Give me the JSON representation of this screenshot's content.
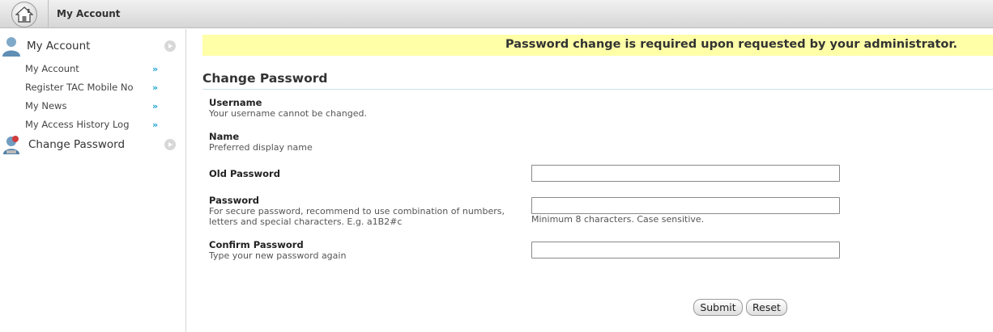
{
  "header": {
    "title": "My Account",
    "home_icon": "home-icon"
  },
  "sidebar": {
    "groups": [
      {
        "label": "My Account",
        "icon": "user-icon",
        "items": [
          {
            "label": "My Account"
          },
          {
            "label": "Register TAC Mobile No"
          },
          {
            "label": "My News"
          },
          {
            "label": "My Access History Log"
          }
        ]
      },
      {
        "label": "Change Password",
        "icon": "password-change-icon",
        "items": []
      }
    ]
  },
  "notice": "Password change is required upon requested by your administrator.",
  "form": {
    "title": "Change Password",
    "username": {
      "label": "Username",
      "desc": "Your username cannot be changed."
    },
    "name": {
      "label": "Name",
      "desc": "Preferred display name"
    },
    "old_password": {
      "label": "Old Password",
      "value": ""
    },
    "password": {
      "label": "Password",
      "desc_line1": "For secure password, recommend to use combination of numbers,",
      "desc_line2": "letters and special characters. E.g. a1B2#c",
      "value": "",
      "hint": "Minimum 8 characters. Case sensitive."
    },
    "confirm_password": {
      "label": "Confirm Password",
      "desc": "Type your new password again",
      "value": ""
    },
    "submit_label": "Submit",
    "reset_label": "Reset"
  },
  "colors": {
    "notice_bg": "#ffffa8",
    "accent_arrow": "#1aa3cc"
  }
}
